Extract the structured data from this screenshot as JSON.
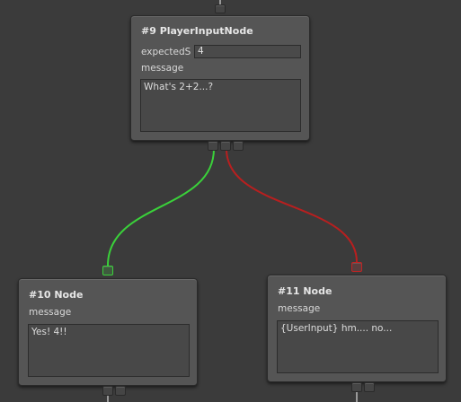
{
  "nodes": {
    "player_input": {
      "title": "#9 PlayerInputNode",
      "expected_label": "expectedS",
      "expected_value": "4",
      "message_label": "message",
      "message_value": "What's 2+2...?"
    },
    "node10": {
      "title": "#10 Node",
      "message_label": "message",
      "message_value": "Yes! 4!!"
    },
    "node11": {
      "title": "#11 Node",
      "message_label": "message",
      "message_value": "{UserInput} hm.... no..."
    }
  },
  "connections": [
    {
      "from": "#9 PlayerInputNode",
      "to": "#10 Node",
      "color": "#3ad13a"
    },
    {
      "from": "#9 PlayerInputNode",
      "to": "#11 Node",
      "color": "#b81f1f"
    }
  ],
  "colors": {
    "canvas": "#3b3b3b",
    "node": "#555555",
    "success_wire": "#3ad13a",
    "failure_wire": "#b81f1f"
  }
}
